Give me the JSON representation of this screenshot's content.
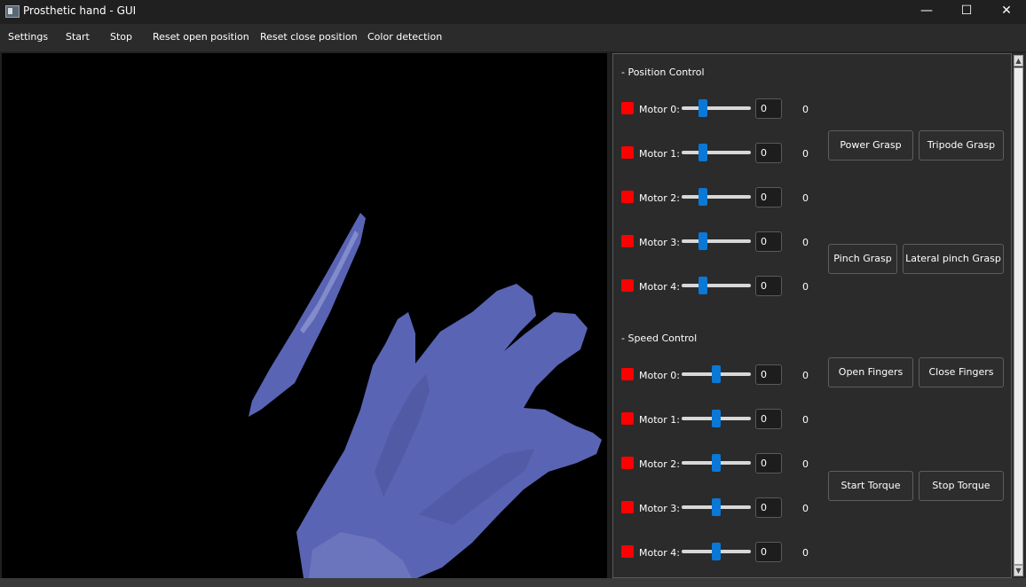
{
  "window": {
    "title": "Prosthetic hand - GUI",
    "controls": {
      "minimize": "—",
      "maximize": "☐",
      "close": "✕"
    }
  },
  "menu": [
    {
      "label": "Settings"
    },
    {
      "label": "Start"
    },
    {
      "label": "Stop"
    },
    {
      "label": "Reset open position"
    },
    {
      "label": "Reset close position"
    },
    {
      "label": "Color detection"
    }
  ],
  "camera": {
    "detected_color": "#5a64b4",
    "background": "#000000"
  },
  "position_control": {
    "title": "- Position Control",
    "motors": [
      {
        "label": "Motor 0:",
        "slider_fraction": 0.28,
        "spin_value": "0",
        "readout": "0",
        "indicator_color": "#ff0000"
      },
      {
        "label": "Motor 1:",
        "slider_fraction": 0.28,
        "spin_value": "0",
        "readout": "0",
        "indicator_color": "#ff0000"
      },
      {
        "label": "Motor 2:",
        "slider_fraction": 0.28,
        "spin_value": "0",
        "readout": "0",
        "indicator_color": "#ff0000"
      },
      {
        "label": "Motor 3:",
        "slider_fraction": 0.28,
        "spin_value": "0",
        "readout": "0",
        "indicator_color": "#ff0000"
      },
      {
        "label": "Motor 4:",
        "slider_fraction": 0.28,
        "spin_value": "0",
        "readout": "0",
        "indicator_color": "#ff0000"
      }
    ]
  },
  "speed_control": {
    "title": "- Speed Control",
    "motors": [
      {
        "label": "Motor 0:",
        "slider_fraction": 0.5,
        "spin_value": "0",
        "readout": "0",
        "indicator_color": "#ff0000"
      },
      {
        "label": "Motor 1:",
        "slider_fraction": 0.5,
        "spin_value": "0",
        "readout": "0",
        "indicator_color": "#ff0000"
      },
      {
        "label": "Motor 2:",
        "slider_fraction": 0.5,
        "spin_value": "0",
        "readout": "0",
        "indicator_color": "#ff0000"
      },
      {
        "label": "Motor 3:",
        "slider_fraction": 0.5,
        "spin_value": "0",
        "readout": "0",
        "indicator_color": "#ff0000"
      },
      {
        "label": "Motor 4:",
        "slider_fraction": 0.5,
        "spin_value": "0",
        "readout": "0",
        "indicator_color": "#ff0000"
      }
    ]
  },
  "grasp_buttons": {
    "power_grasp": "Power Grasp",
    "tripode_grasp": "Tripode Grasp",
    "pinch_grasp": "Pinch Grasp",
    "lateral_pinch_grasp": "Lateral pinch Grasp",
    "open_fingers": "Open Fingers",
    "close_fingers": "Close Fingers",
    "start_torque": "Start Torque",
    "stop_torque": "Stop Torque"
  },
  "accent_color": "#0a78d7"
}
